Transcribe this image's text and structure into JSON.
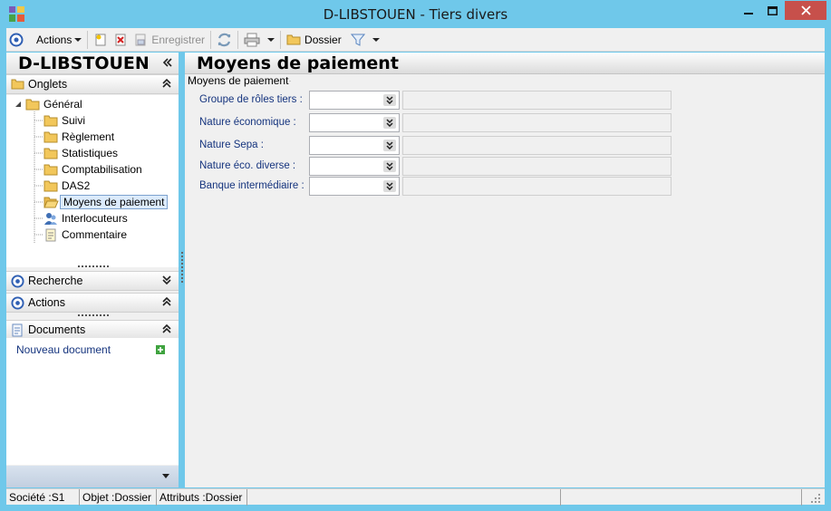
{
  "window": {
    "title": "D-LIBSTOUEN -  Tiers divers",
    "minimize_icon": "minimize-icon",
    "maximize_icon": "maximize-icon",
    "close_icon": "close-icon"
  },
  "toolbar": {
    "actions_label": "Actions",
    "save_label": "Enregistrer",
    "folder_label": "Dossier"
  },
  "left": {
    "title": "D-LIBSTOUEN",
    "onglets_label": "Onglets",
    "tree": {
      "root": "Général",
      "items": [
        "Suivi",
        "Règlement",
        "Statistiques",
        "Comptabilisation",
        "DAS2",
        "Moyens de paiement",
        "Interlocuteurs",
        "Commentaire"
      ],
      "selected": "Moyens de paiement"
    },
    "recherche_label": "Recherche",
    "actions_label": "Actions",
    "documents_label": "Documents",
    "new_document_label": "Nouveau document"
  },
  "main": {
    "title": "Moyens de paiement",
    "group_label": "Moyens de paiement",
    "fields": [
      {
        "label": "Groupe de rôles tiers :",
        "value": "",
        "description": ""
      },
      {
        "label": "Nature économique :",
        "value": "",
        "description": ""
      },
      {
        "label": "Nature Sepa :",
        "value": "",
        "description": ""
      },
      {
        "label": "Nature éco. diverse :",
        "value": "",
        "description": ""
      },
      {
        "label": "Banque intermédiaire :",
        "value": "",
        "description": ""
      }
    ]
  },
  "status": {
    "societe": "Société :S1",
    "objet": "Objet :Dossier",
    "attributs": "Attributs :Dossier"
  },
  "colors": {
    "window_frame": "#6fc8ea",
    "close_button": "#c7504b",
    "field_label": "#15347e",
    "selection": "#dcebfc"
  }
}
